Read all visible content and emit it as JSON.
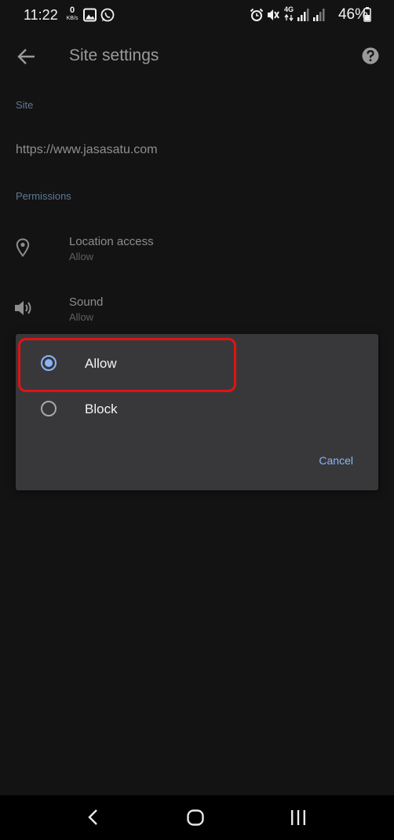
{
  "status_bar": {
    "time": "11:22",
    "net_speed_value": "0",
    "net_speed_unit": "KB/s",
    "network_type": "4G",
    "battery": "46%"
  },
  "app_bar": {
    "title": "Site settings"
  },
  "site_section": {
    "header": "Site",
    "url": "https://www.jasasatu.com"
  },
  "permissions_section": {
    "header": "Permissions",
    "items": [
      {
        "title": "Location access",
        "value": "Allow",
        "icon": "location-pin-icon"
      },
      {
        "title": "Sound",
        "value": "Allow",
        "icon": "speaker-icon"
      }
    ]
  },
  "dialog": {
    "options": [
      {
        "label": "Allow",
        "selected": true
      },
      {
        "label": "Block",
        "selected": false
      }
    ],
    "cancel_label": "Cancel"
  },
  "colors": {
    "accent": "#8ab4f8",
    "highlight": "#e01313",
    "dialog_bg": "#38383b",
    "background": "#131313"
  }
}
